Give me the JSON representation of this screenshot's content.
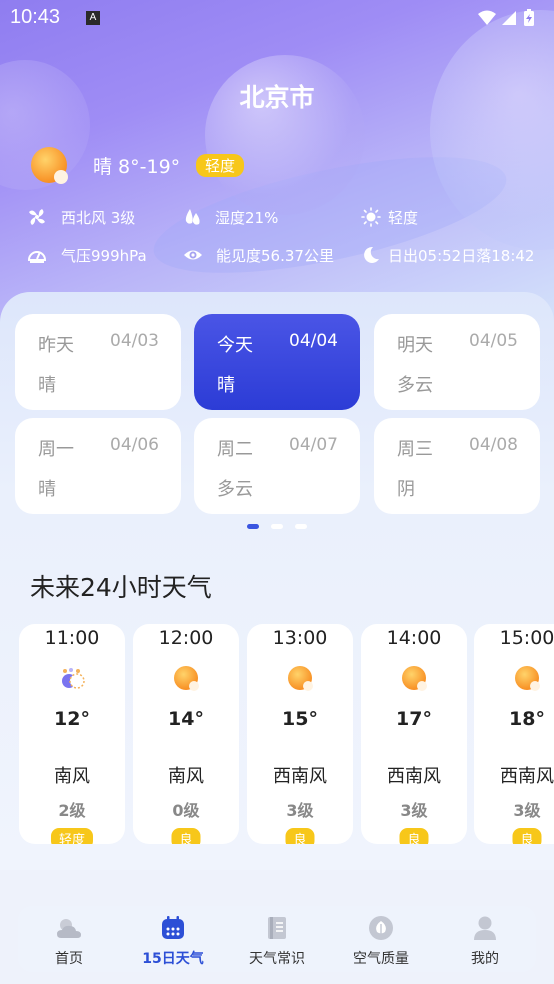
{
  "status_bar": {
    "time": "10:43",
    "notif_letter": "A"
  },
  "city": "北京市",
  "current": {
    "condition_temp": "晴  8°-19°",
    "air_quality": "轻度"
  },
  "details": {
    "wind": "西北风 3级",
    "humidity": "湿度21%",
    "air": "轻度",
    "pressure": "气压999hPa",
    "visibility": "能见度56.37公里",
    "sun": "日出05:52日落18:42"
  },
  "days": [
    {
      "name": "昨天",
      "date": "04/03",
      "cond": "晴"
    },
    {
      "name": "今天",
      "date": "04/04",
      "cond": "晴"
    },
    {
      "name": "明天",
      "date": "04/05",
      "cond": "多云"
    },
    {
      "name": "周一",
      "date": "04/06",
      "cond": "晴"
    },
    {
      "name": "周二",
      "date": "04/07",
      "cond": "多云"
    },
    {
      "name": "周三",
      "date": "04/08",
      "cond": "阴"
    }
  ],
  "hourly_title": "未来24小时天气",
  "hourly": [
    {
      "time": "11:00",
      "temp": "12°",
      "wind": "南风",
      "level": "2级",
      "aq": "轻度",
      "icon": "cloudy-night-icon"
    },
    {
      "time": "12:00",
      "temp": "14°",
      "wind": "南风",
      "level": "0级",
      "aq": "良",
      "icon": "sun-icon"
    },
    {
      "time": "13:00",
      "temp": "15°",
      "wind": "西南风",
      "level": "3级",
      "aq": "良",
      "icon": "sun-icon"
    },
    {
      "time": "14:00",
      "temp": "17°",
      "wind": "西南风",
      "level": "3级",
      "aq": "良",
      "icon": "sun-icon"
    },
    {
      "time": "15:00",
      "temp": "18°",
      "wind": "西南风",
      "level": "3级",
      "aq": "良",
      "icon": "sun-icon"
    }
  ],
  "nav": [
    {
      "label": "首页",
      "icon": "cloud-sun-icon"
    },
    {
      "label": "15日天气",
      "icon": "calendar-icon"
    },
    {
      "label": "天气常识",
      "icon": "book-icon"
    },
    {
      "label": "空气质量",
      "icon": "leaf-icon"
    },
    {
      "label": "我的",
      "icon": "user-icon"
    }
  ],
  "colors": {
    "accent": "#2c4fd6",
    "badge": "#f7c71a",
    "active_card": "#3a47de"
  }
}
